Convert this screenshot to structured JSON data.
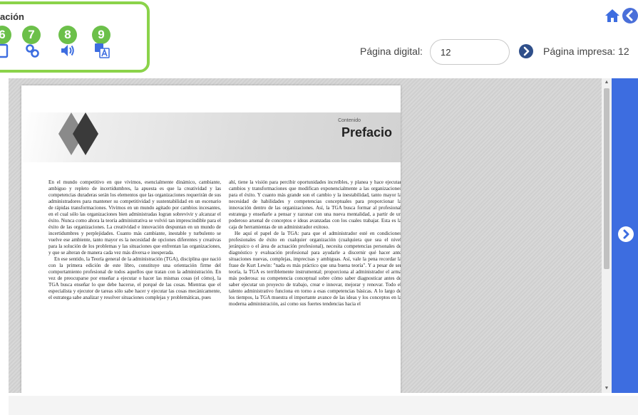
{
  "toolbar": {
    "title": "ación",
    "badges": [
      "6",
      "7",
      "8",
      "9"
    ],
    "tools": [
      {
        "name": "bookmark",
        "icon": "page-icon"
      },
      {
        "name": "link",
        "icon": "link-icon"
      },
      {
        "name": "audio",
        "icon": "speaker-icon"
      },
      {
        "name": "translate",
        "icon": "translate-icon"
      }
    ],
    "highlight_color": "#8bd34a",
    "badge_color": "#6cc04a",
    "icon_color": "#3d6de0"
  },
  "nav": {
    "digital_label": "Página digital:",
    "digital_value": "12",
    "printed_label": "Página impresa: 12"
  },
  "page": {
    "kicker": "Contenido",
    "title": "Prefacio",
    "left_paragraphs": [
      "En el mundo competitivo en que vivimos, esencialmente dinámico, cambiante, ambiguo y repleto de incertidumbres, la apuesta es que la creatividad y las competencias duraderas serán los elementos que las organizaciones requerirán de sus administradores para mantener su competitividad y sustentabilidad en un escenario de rápidas transformaciones. Vivimos en un mundo agitado por cambios incesantes, en el cual sólo las organizaciones bien administradas logran sobrevivir y alcanzar el éxito. Nunca como ahora la teoría administrativa se volvió tan imprescindible para el éxito de las organizaciones. La creatividad e innovación despuntan en un mundo de incertidumbres y perplejidades. Cuanto más cambiante, inestable y turbulento se vuelve ese ambiente, tanto mayor es la necesidad de opciones diferentes y creativas para la solución de los problemas y las situaciones que enfrentan las organizaciones, y que se alteran de manera cada vez más diversa e inesperada.",
      "En ese sentido, la Teoría general de la administración (TGA), disciplina que nació con la primera edición de este libro, constituye una orientación firme del comportamiento profesional de todos aquellos que tratan con la administración. En vez de preocuparse por enseñar a ejecutar o hacer las mismas cosas (el cómo), la TGA busca enseñar lo que debe hacerse, el porqué de las cosas. Mientras que el especialista y ejecutor de tareas sólo sabe hacer y ejecutar las cosas mecánicamente, el estratega sabe analizar y resolver situaciones complejas y problemáticas, pues"
    ],
    "right_paragraphs": [
      "ahí, tiene la visión para percibir oportunidades increíbles, y planea y hace ejecutar cambios y transformaciones que modifican exponencialmente a las organizaciones para el éxito. Y cuanto más grande son el cambio y la inestabilidad, tanto mayor la necesidad de habilidades y competencias conceptuales para proporcionar la innovación dentro de las organizaciones. Así, la TGA busca formar al profesional estratega y enseñarle a pensar y razonar con una nueva mentalidad, a partir de un poderoso arsenal de conceptos e ideas avanzadas con los cuales trabajar. Esta es la caja de herramientas de un administrador exitoso.",
      "He aquí el papel de la TGA: para que el administrador esté en condiciones profesionales de éxito en cualquier organización (cualquiera que sea el nivel jerárquico o el área de actuación profesional), necesita competencias personales de diagnóstico y evaluación profesional para ayudarle a discernir qué hacer ante situaciones nuevas, complejas, imprecisas y ambiguas. Así, vale la pena recordar la frase de Kurt Lewin: \"nada es más práctico que una buena teoría\". Y a pesar de ser teoría, la TGA es terriblemente instrumental; proporciona al administrador el arma más poderosa: su competencia conceptual sobre cómo saber diagnosticar antes de saber ejecutar un proyecto de trabajo, crear e innovar, mejorar y renovar. Todo el talento administrativo funciona en torno a esas competencias básicas. A lo largo de los tiempos, la TGA muestra el importante avance de las ideas y los conceptos en la moderna administración, así como sus fuertes tendencias hacia el"
    ]
  }
}
